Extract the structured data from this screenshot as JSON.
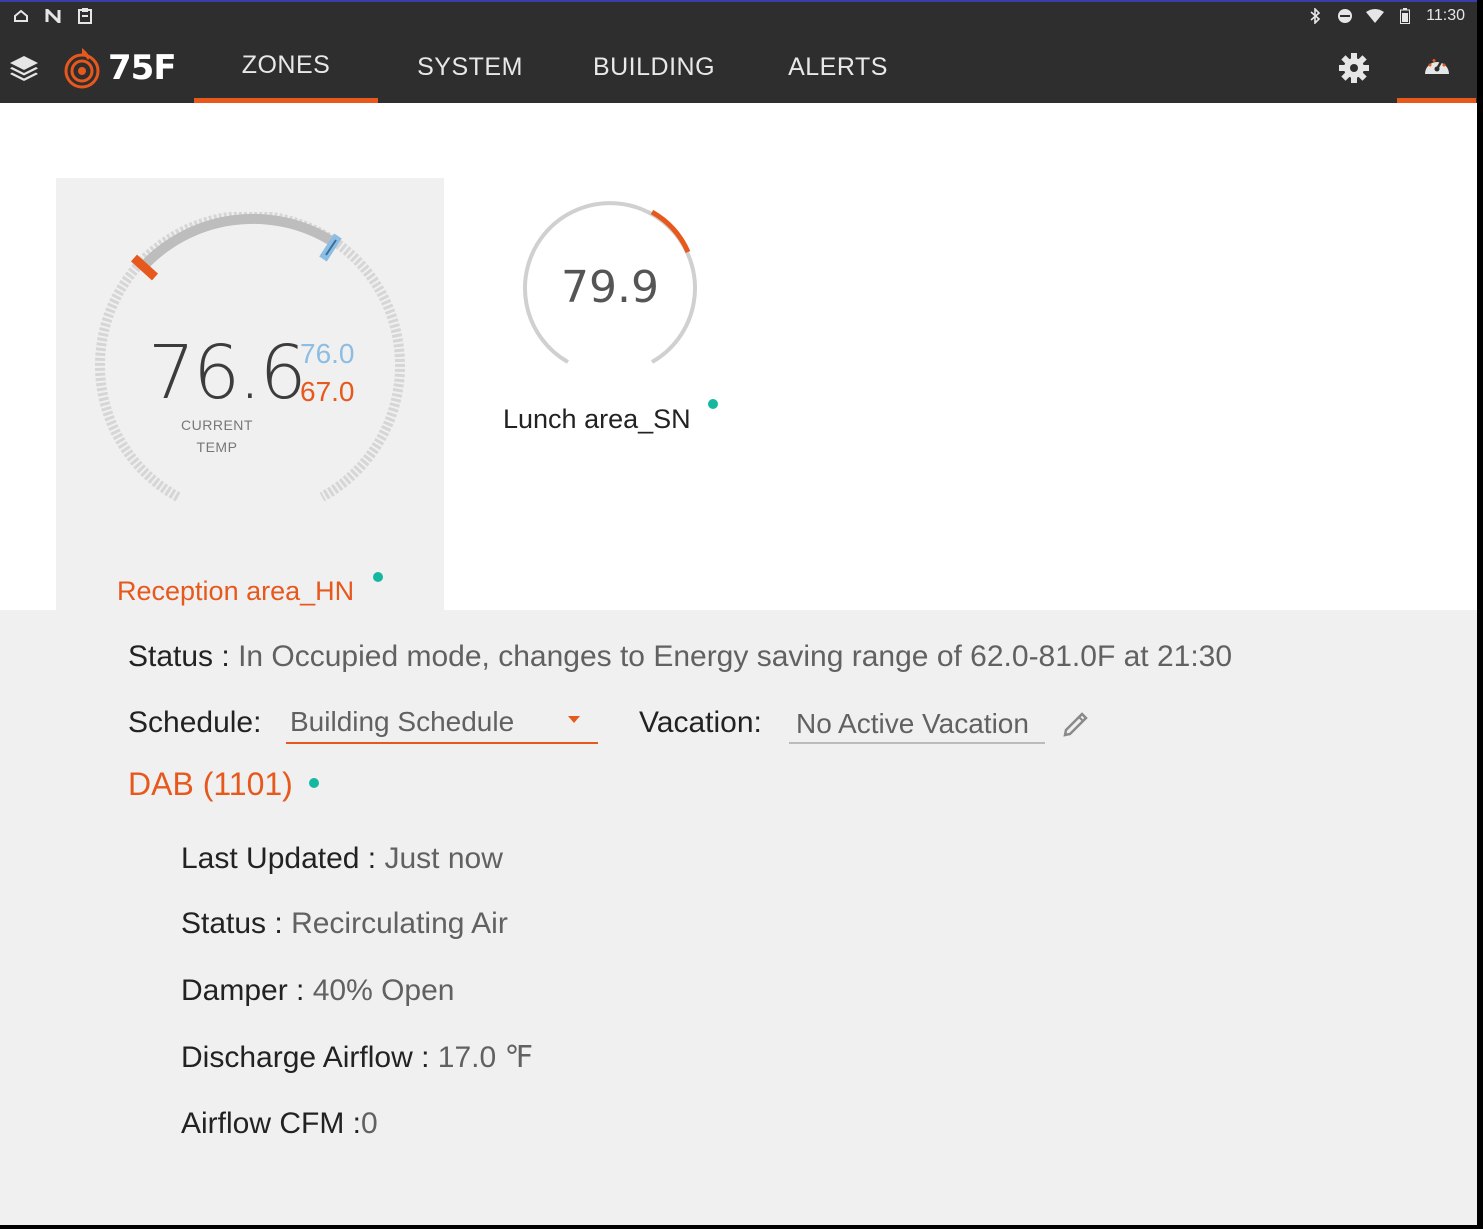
{
  "statusbar": {
    "time": "11:30",
    "left_icons": [
      "home-outline-icon",
      "n-icon",
      "clipboard-icon"
    ],
    "right_icons": [
      "bluetooth-icon",
      "do-not-disturb-icon",
      "wifi-icon",
      "battery-icon"
    ]
  },
  "nav": {
    "brand": "75F",
    "tabs": [
      {
        "label": "ZONES",
        "active": true
      },
      {
        "label": "SYSTEM",
        "active": false
      },
      {
        "label": "BUILDING",
        "active": false
      },
      {
        "label": "ALERTS",
        "active": false
      }
    ],
    "icons": [
      "layers-icon",
      "gear-icon",
      "dashboard-gauge-icon"
    ]
  },
  "zones": [
    {
      "name": "Reception area_HN",
      "current_temp": "76.6",
      "cooling_setpoint": "76.0",
      "heating_setpoint": "67.0",
      "current_label_line1": "CURRENT",
      "current_label_line2": "TEMP",
      "selected": true,
      "online": true
    },
    {
      "name": "Lunch area_SN",
      "current_temp": "79.9",
      "selected": false,
      "online": true
    }
  ],
  "detail": {
    "status_label": "Status :",
    "status_value": "In Occupied mode, changes to Energy saving range of 62.0-81.0F at 21:30",
    "schedule_label": "Schedule:",
    "schedule_value": "Building Schedule",
    "vacation_label": "Vacation:",
    "vacation_value": "No Active Vacation",
    "device_title": "DAB (1101)",
    "device_online": true,
    "rows": [
      {
        "label": "Last Updated : ",
        "value": "Just now"
      },
      {
        "label": "Status : ",
        "value": "Recirculating Air"
      },
      {
        "label": "Damper : ",
        "value": "40% Open"
      },
      {
        "label": "Discharge Airflow : ",
        "value": "17.0 ℉"
      },
      {
        "label": "Airflow CFM :",
        "value": "0"
      }
    ]
  },
  "colors": {
    "accent": "#e7581d",
    "cool": "#8cbde3",
    "online": "#14b8a0",
    "navbar": "#2e2e2e",
    "panel": "#f0f0f0"
  }
}
